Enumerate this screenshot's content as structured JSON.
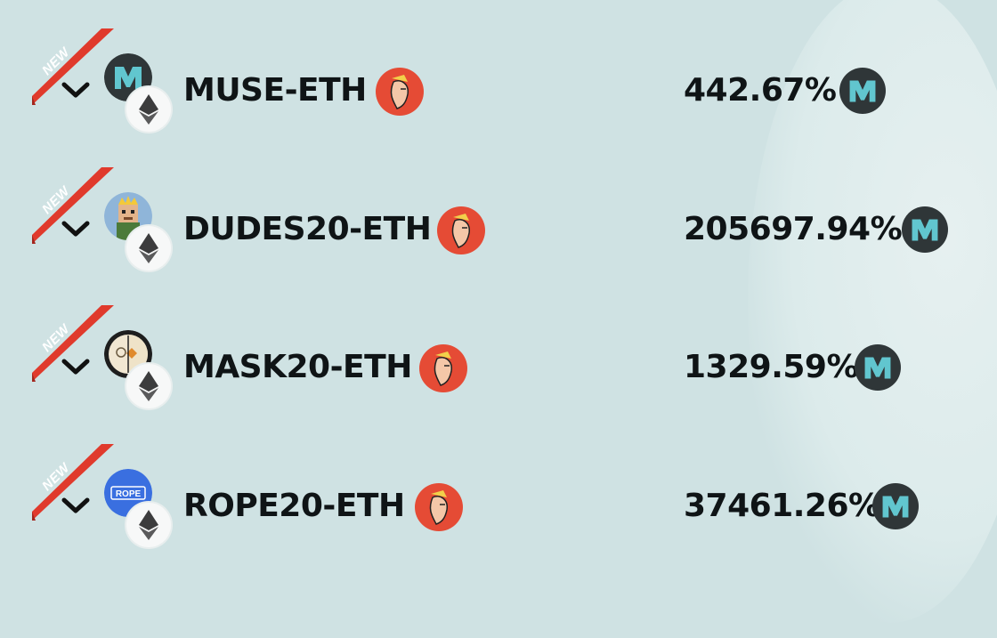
{
  "ribbon_label": "NEW",
  "colors": {
    "background": "#cfe2e3",
    "ribbon": "#e03a2c",
    "text": "#0f1416",
    "muse_teal": "#61c6cf",
    "muse_dark": "#2f3638",
    "avatar_red": "#e54b35"
  },
  "pairs": [
    {
      "name": "MUSE-ETH",
      "apr": "442.67%",
      "token_icon": "muse-token-icon",
      "reward_icon": "muse-token-icon"
    },
    {
      "name": "DUDES20-ETH",
      "apr": "205697.94%",
      "token_icon": "dudes-token-icon",
      "reward_icon": "muse-token-icon"
    },
    {
      "name": "MASK20-ETH",
      "apr": "1329.59%",
      "token_icon": "mask-token-icon",
      "reward_icon": "muse-token-icon"
    },
    {
      "name": "ROPE20-ETH",
      "apr": "37461.26%",
      "token_icon": "rope-token-icon",
      "reward_icon": "muse-token-icon"
    }
  ],
  "rope_logo_text": "ROPE"
}
